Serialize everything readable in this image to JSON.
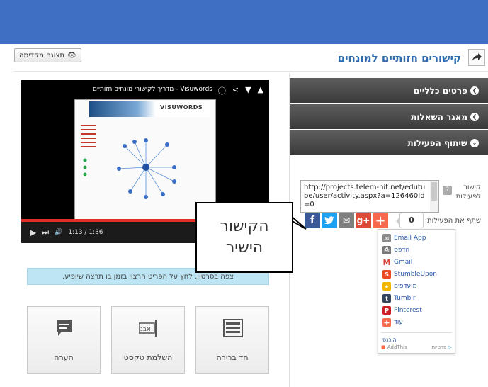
{
  "header": {
    "title": "קישורים חזותיים למונחים",
    "preview_label": "תצוגה מקדימה"
  },
  "accordion": [
    {
      "label": "פרטים כלליים",
      "icon": "chevron-right-icon"
    },
    {
      "label": "מאגר השאלות",
      "icon": "chevron-right-icon"
    },
    {
      "label": "שיתוף הפעילות",
      "icon": "chevron-down-icon"
    }
  ],
  "share_section": {
    "link_label": "קישור לפעילות",
    "help_glyph": "?",
    "link_value": "http://projects.telem-hit.net/edutube/user/activity.aspx?a=126460Id=0",
    "share_label": "שתף את הפעילות:",
    "count": "0",
    "buttons": [
      {
        "name": "facebook",
        "glyph": "f",
        "color": "#3b5998"
      },
      {
        "name": "twitter",
        "glyph": "t",
        "color": "#1da1f2"
      },
      {
        "name": "email",
        "glyph": "✉",
        "color": "#7f7f7f"
      },
      {
        "name": "google-plus",
        "glyph": "g+",
        "color": "#dd4b39"
      },
      {
        "name": "more",
        "glyph": "+",
        "color": "#f8694d"
      }
    ],
    "menu": {
      "items": [
        {
          "label": "Email App",
          "icon": "email-app-icon",
          "glyph": "✉",
          "color": "#8a8a8a"
        },
        {
          "label": "הדפס",
          "icon": "print-icon",
          "glyph": "⎙",
          "color": "#777777"
        },
        {
          "label": "Gmail",
          "icon": "gmail-icon",
          "glyph": "M",
          "color": "#db4437"
        },
        {
          "label": "StumbleUpon",
          "icon": "stumbleupon-icon",
          "glyph": "S",
          "color": "#eb4924"
        },
        {
          "label": "מועדפים",
          "icon": "favorites-icon",
          "glyph": "★",
          "color": "#f2b600"
        },
        {
          "label": "Tumblr",
          "icon": "tumblr-icon",
          "glyph": "t",
          "color": "#35465c"
        },
        {
          "label": "Pinterest",
          "icon": "pinterest-icon",
          "glyph": "P",
          "color": "#cb2027"
        },
        {
          "label": "עוד",
          "icon": "more-icon",
          "glyph": "+",
          "color": "#f8694d"
        }
      ],
      "footer_left": "AddThis",
      "footer_right": "פרטיות",
      "login": "היכנס"
    }
  },
  "video": {
    "title": "Visuwords - מדריך לקישורי מונחים חזותיים",
    "logo": "VISUWORDS",
    "time": "1:13 / 1:36",
    "progress": 0.76
  },
  "info_text": "צפה בסרטון. לחץ על הפריט הרצוי בזמן בו תרצה שיופיע.",
  "tools": [
    {
      "label": "חד ברירה",
      "icon": "multiple-choice-icon"
    },
    {
      "label": "השלמת טקסט",
      "icon": "text-completion-icon"
    },
    {
      "label": "הערה",
      "icon": "comment-icon"
    }
  ],
  "callout": {
    "line1": "הקישור",
    "line2": "הישיר"
  }
}
